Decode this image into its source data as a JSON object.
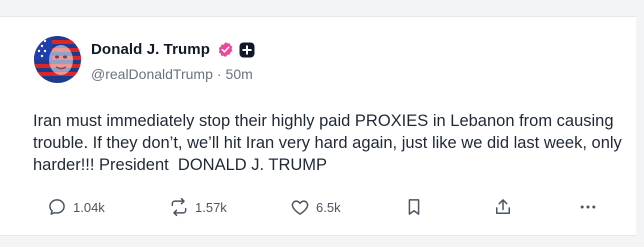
{
  "post": {
    "author_name": "Donald J. Trump",
    "handle": "@realDonaldTrump",
    "separator": "·",
    "time_ago": "50m",
    "text": "Iran must immediately stop their highly paid PROXIES in Lebanon from causing trouble. If they don’t, we’ll hit Iran very hard again, just like we did last week, only harder!!! President  DONALD J. TRUMP"
  },
  "actions": {
    "replies": "1.04k",
    "retruths": "1.57k",
    "likes": "6.5k"
  },
  "icons": {
    "verified": "verified-badge-icon",
    "plus": "plus-square-icon",
    "reply": "comment-bubble-icon",
    "retruth": "repost-arrows-icon",
    "like": "heart-icon",
    "bookmark": "bookmark-icon",
    "share": "share-upload-icon",
    "more": "more-horizontal-icon"
  },
  "colors": {
    "verified_badge": "#ec4899",
    "text_primary": "#111827",
    "text_secondary": "#6b7280"
  }
}
